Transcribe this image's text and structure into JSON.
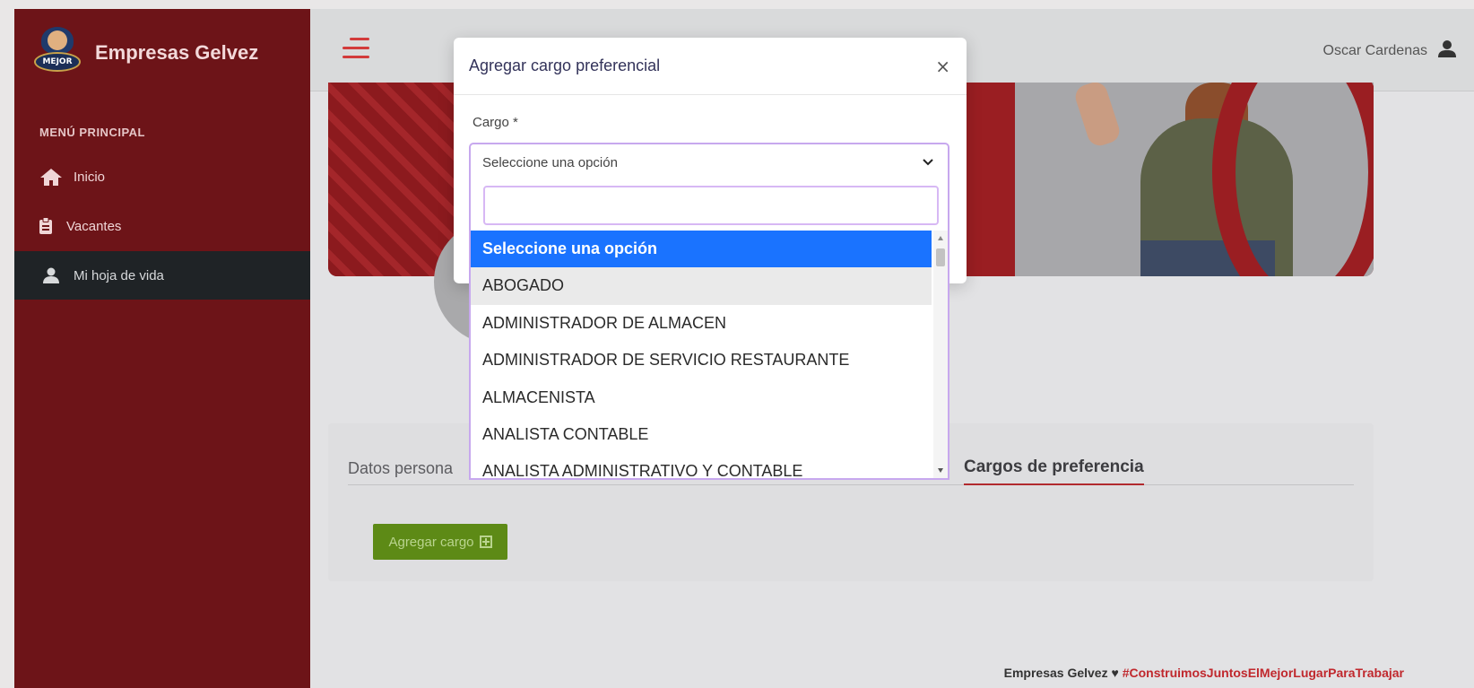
{
  "sidebar": {
    "brand": "Empresas Gelvez",
    "logo_text": "MEJOR",
    "menu_title": "MENÚ PRINCIPAL",
    "items": [
      {
        "label": "Inicio",
        "icon": "home-icon"
      },
      {
        "label": "Vacantes",
        "icon": "clipboard-icon"
      },
      {
        "label": "Mi hoja de vida",
        "icon": "user-id-icon",
        "active": true
      }
    ]
  },
  "topbar": {
    "user_name": "Oscar Cardenas",
    "user_icon": "user-icon",
    "menu_icon": "hamburger-icon"
  },
  "content": {
    "tabs": [
      {
        "label": "Datos persona"
      },
      {
        "label": "Cargos de preferencia",
        "active": true
      }
    ],
    "add_button_label": "Agregar cargo",
    "footer_brand": "Empresas Gelvez",
    "footer_heart": "♥",
    "footer_tag": "#ConstruimosJuntosElMejorLugarParaTrabajar"
  },
  "modal": {
    "title": "Agregar cargo preferencial",
    "close_symbol": "×",
    "field_label": "Cargo *",
    "select_value": "Seleccione una opción",
    "search_value": "",
    "options": [
      "Seleccione una opción",
      "ABOGADO",
      "ADMINISTRADOR DE ALMACEN",
      "ADMINISTRADOR DE SERVICIO RESTAURANTE",
      "ALMACENISTA",
      "ANALISTA CONTABLE",
      "ANALISTA ADMINISTRATIVO Y CONTABLE"
    ],
    "selected_index": 0,
    "hover_index": 1
  },
  "colors": {
    "sidebar_bg": "#6d1418",
    "accent_red": "#c0282d",
    "selected_option": "#1a73ff",
    "add_button": "#5d8a16",
    "focus_border": "#c7a8ee"
  }
}
